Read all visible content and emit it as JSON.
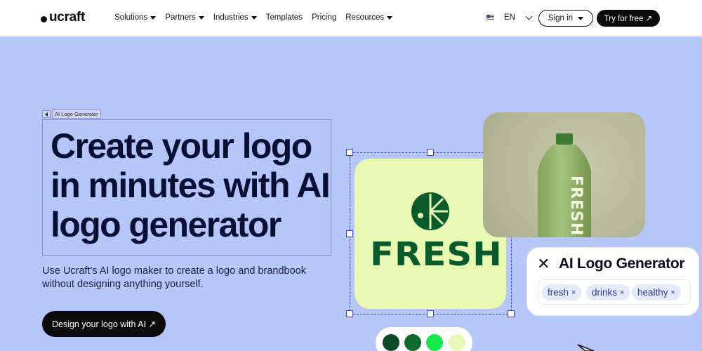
{
  "nav": {
    "brand": "ucraft",
    "menu": [
      "Solutions",
      "Partners",
      "Industries",
      "Templates",
      "Pricing",
      "Resources"
    ],
    "menu_has_caret": [
      true,
      true,
      true,
      false,
      false,
      true
    ],
    "language": "EN",
    "sign_in": "Sign in",
    "try_free": "Try for free ↗"
  },
  "hero": {
    "breadcrumb": "AI Logo Generator",
    "headline": "Create your logo in minutes with AI logo generator",
    "description": "Use Ucraft's AI logo maker to create a logo and brandbook without designing anything yourself.",
    "cta": "Design your logo with AI ↗"
  },
  "visual": {
    "logo_word": "FRESH",
    "bottle_word": "FRESH",
    "generator_title": "AI Logo Generator",
    "close_icon": "✕",
    "tags": [
      "fresh",
      "drinks",
      "healthy"
    ],
    "tag_remove": "×",
    "swatches": [
      "#0e4a25",
      "#0f6b2d",
      "#14e84f",
      "#e8f8b9"
    ]
  },
  "colors": {
    "background": "#b6c6f9",
    "accent_green": "#0b5a2b",
    "selection": "#3e44c9"
  }
}
